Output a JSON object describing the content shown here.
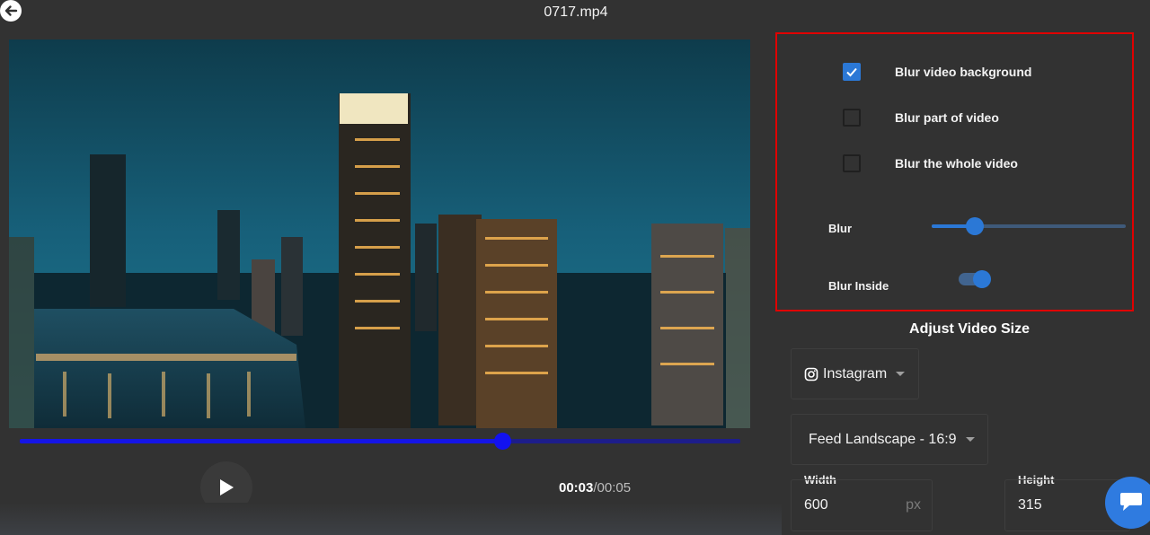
{
  "header": {
    "file_name": "0717.mp4"
  },
  "player": {
    "current_time": "00:03",
    "total_time": "/00:05",
    "progress": 0.67
  },
  "blur_options": {
    "items": [
      {
        "label": "Blur video background",
        "checked": true
      },
      {
        "label": "Blur part of video",
        "checked": false
      },
      {
        "label": "Blur the whole video",
        "checked": false
      }
    ],
    "blur_label": "Blur",
    "blur_value": 0.22,
    "blur_inside_label": "Blur Inside",
    "blur_inside_on": true
  },
  "adjust": {
    "title": "Adjust Video Size",
    "platform": "Instagram",
    "preset": "Feed Landscape - 16:9",
    "width_label": "Width",
    "width_value": "600",
    "width_unit": "px",
    "height_label": "Height",
    "height_value": "315"
  },
  "colors": {
    "accent": "#2b78d6",
    "panel_border": "#e00000",
    "progress": "#1515e6"
  },
  "icons": {
    "back": "back-arrow-icon",
    "play": "play-icon",
    "instagram": "instagram-icon",
    "chat": "chat-icon",
    "check": "checkmark-icon"
  }
}
